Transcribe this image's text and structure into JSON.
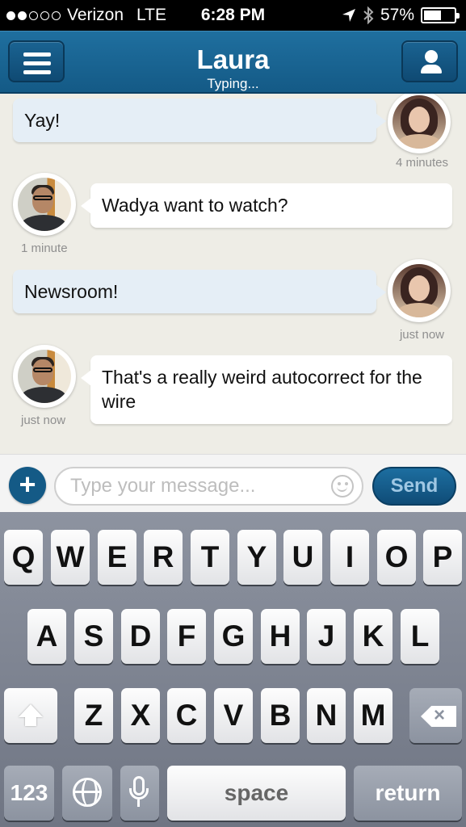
{
  "status_bar": {
    "carrier": "Verizon",
    "network": "LTE",
    "time": "6:28 PM",
    "battery": "57%",
    "battery_level": 0.57,
    "signal_bars": 2
  },
  "nav": {
    "title": "Laura",
    "subtitle": "Typing...",
    "accent_color": "#145a86"
  },
  "messages": [
    {
      "sender": "Laura",
      "text": "Yay!",
      "timestamp": "4 minutes"
    },
    {
      "sender": "me",
      "text": "Wadya want to watch?",
      "timestamp": "1 minute"
    },
    {
      "sender": "Laura",
      "text": "Newsroom!",
      "timestamp": "just now"
    },
    {
      "sender": "me",
      "text": "That's a really weird autocorrect for the wire",
      "timestamp": "just now"
    }
  ],
  "composer": {
    "placeholder": "Type your message...",
    "value": "",
    "send_label": "Send",
    "plus_label": "+"
  },
  "keyboard": {
    "row1": [
      "Q",
      "W",
      "E",
      "R",
      "T",
      "Y",
      "U",
      "I",
      "O",
      "P"
    ],
    "row2": [
      "A",
      "S",
      "D",
      "F",
      "G",
      "H",
      "J",
      "K",
      "L"
    ],
    "row3": [
      "Z",
      "X",
      "C",
      "V",
      "B",
      "N",
      "M"
    ],
    "numbers_label": "123",
    "space_label": "space",
    "return_label": "return"
  }
}
